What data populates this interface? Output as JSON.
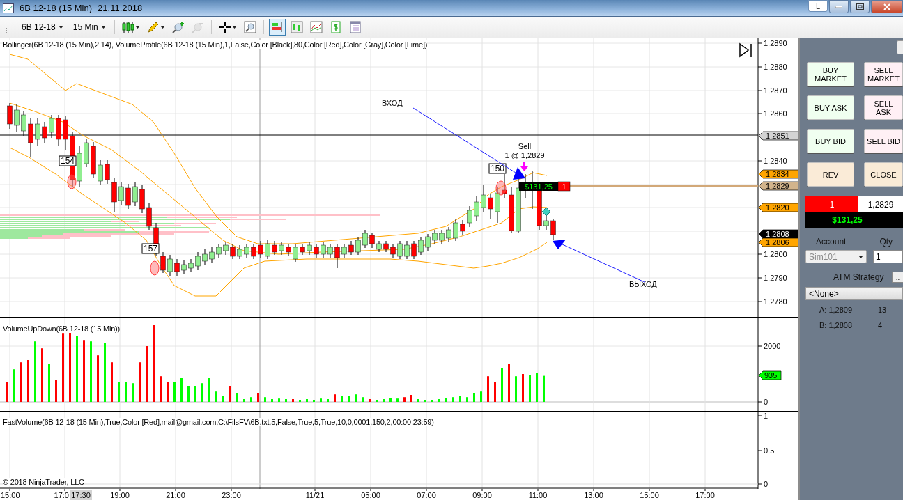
{
  "window": {
    "title": "6B 12-18 (15 Min)",
    "date": "21.11.2018",
    "layout_button": "L"
  },
  "toolbar": {
    "instrument": "6B 12-18",
    "interval": "15 Min",
    "tools": [
      {
        "selected": false,
        "disabled": false
      },
      {
        "selected": false,
        "disabled": false
      },
      {
        "selected": false,
        "disabled": false
      },
      {
        "selected": false,
        "disabled": true
      },
      {
        "selected": false,
        "disabled": false
      },
      {
        "selected": false,
        "disabled": false
      },
      {
        "selected": true,
        "disabled": false
      },
      {
        "selected": false,
        "disabled": false
      },
      {
        "selected": false,
        "disabled": false
      },
      {
        "selected": false,
        "disabled": false
      },
      {
        "selected": false,
        "disabled": false
      }
    ]
  },
  "price_panel": {
    "indicator_label": "Bollinger(6B 12-18 (15 Min),2,14), VolumeProfile(6B 12-18 (15 Min),1,False,Color [Black],80,Color [Red],Color [Gray],Color [Lime])",
    "axis_labels": [
      "1,2890",
      "1,2880",
      "1,2870",
      "1,2860",
      "1,2840",
      "1,2800",
      "1,2790",
      "1,2780"
    ],
    "price_tags": [
      {
        "text": "1,2851",
        "color": "#d3d3d3"
      },
      {
        "text": "1,2834",
        "color": "#ffa500"
      },
      {
        "text": "1,2829",
        "color": "#d2b48c"
      },
      {
        "text": "1,2820",
        "color": "#ffa500"
      },
      {
        "text": "1,2808",
        "color": "#000000"
      },
      {
        "text": "1,2806",
        "color": "#ffa500"
      }
    ],
    "entry_label": "ВХОД",
    "exit_label": "ВЫХОД",
    "execution": {
      "side": "Sell",
      "detail": "1 @ 1,2829"
    },
    "bar_labels": [
      "154",
      "157",
      "150"
    ],
    "position_marker": {
      "pnl": "$131,25",
      "quantity": "1"
    }
  },
  "volume_panel": {
    "indicator_label": "VolumeUpDown(6B 12-18 (15 Min))",
    "last_value": "935",
    "axis_labels": [
      "2000",
      "0"
    ]
  },
  "fast_panel": {
    "indicator_label": "FastVolume(6B 12-18 (15 Min),True,Color [Red],mail@gmail.com,C:\\FilsFV\\6B.txt,5,False,True,5,True,10,0,0001,150,2,00:00,23:59)",
    "axis_labels": [
      "1",
      "0,5",
      "0"
    ],
    "copyright": "© 2018 NinjaTrader, LLC"
  },
  "time_axis": {
    "labels": [
      "15:00",
      "17:0",
      "19:00",
      "21:00",
      "23:00",
      "11/21",
      "05:00",
      "07:00",
      "09:00",
      "11:00",
      "13:00",
      "15:00",
      "17:00"
    ],
    "cursor_label": "17:30"
  },
  "order_panel": {
    "buttons": [
      {
        "label": "BUY MARKET",
        "kind": "buy"
      },
      {
        "label": "SELL MARKET",
        "kind": "sell"
      },
      {
        "label": "BUY ASK",
        "kind": "buy"
      },
      {
        "label": "SELL ASK",
        "kind": "sell"
      },
      {
        "label": "BUY BID",
        "kind": "buy"
      },
      {
        "label": "SELL BID",
        "kind": "sell"
      },
      {
        "label": "REV",
        "kind": "neutral"
      },
      {
        "label": "CLOSE",
        "kind": "neutral"
      }
    ],
    "position": {
      "quantity": "1",
      "price": "1,2829",
      "pnl": "$131,25"
    },
    "account_label": "Account",
    "account_value": "Sim101",
    "account_disabled": true,
    "qty_label": "Qty",
    "qty_value": "1",
    "atm_label": "ATM Strategy",
    "atm_button": "..",
    "atm_value": "<None>",
    "quotes": [
      {
        "label": "A: 1,2809",
        "size": "13"
      },
      {
        "label": "B: 1,2808",
        "size": "4"
      }
    ]
  }
}
